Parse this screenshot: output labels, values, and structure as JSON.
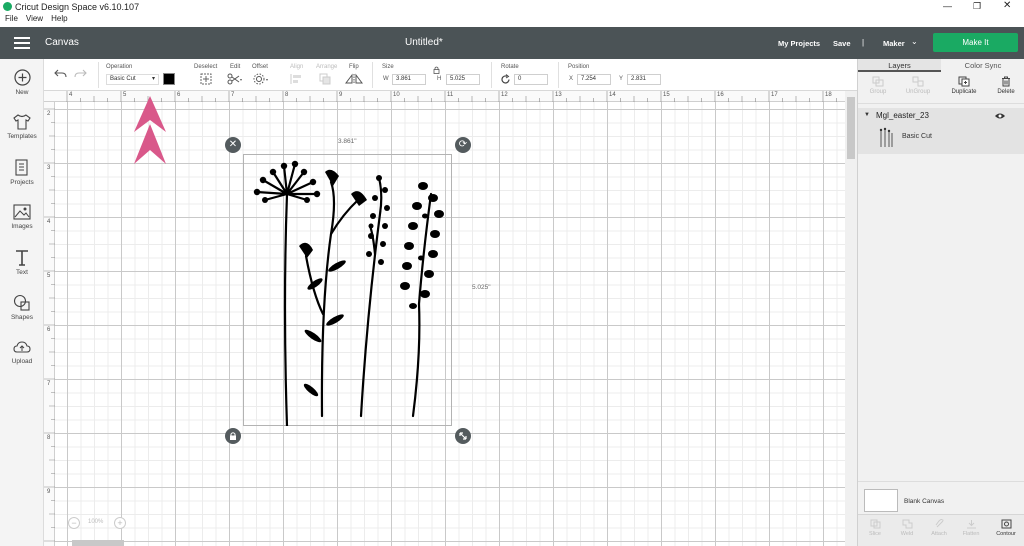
{
  "window": {
    "title": "Cricut Design Space  v6.10.107",
    "menu": [
      "File",
      "View",
      "Help"
    ]
  },
  "header": {
    "canvas_label": "Canvas",
    "doc_title": "Untitled*",
    "my_projects": "My Projects",
    "save": "Save",
    "separator": "|",
    "machine": "Maker",
    "make_it": "Make It",
    "accent": "#1aaa63"
  },
  "toolbar": {
    "operation_label": "Operation",
    "operation_value": "Basic Cut",
    "deselect": "Deselect",
    "edit": "Edit",
    "offset": "Offset",
    "align": "Align",
    "arrange": "Arrange",
    "flip": "Flip",
    "size_label": "Size",
    "w_label": "W",
    "w_value": "3.861",
    "h_label": "H",
    "h_value": "5.025",
    "rotate_label": "Rotate",
    "rotate_value": "0",
    "position_label": "Position",
    "x_label": "X",
    "x_value": "7.254",
    "y_label": "Y",
    "y_value": "2.831"
  },
  "nav": [
    {
      "label": "New",
      "icon": "plus-circle-icon"
    },
    {
      "label": "Templates",
      "icon": "shirt-icon"
    },
    {
      "label": "Projects",
      "icon": "projects-icon"
    },
    {
      "label": "Images",
      "icon": "image-icon"
    },
    {
      "label": "Text",
      "icon": "text-icon"
    },
    {
      "label": "Shapes",
      "icon": "shapes-icon"
    },
    {
      "label": "Upload",
      "icon": "upload-icon"
    }
  ],
  "ruler": {
    "top": [
      "4",
      "5",
      "6",
      "7",
      "8",
      "9",
      "10",
      "11",
      "12",
      "13",
      "14",
      "15",
      "16",
      "17",
      "18"
    ],
    "left": [
      "2",
      "3",
      "4",
      "5",
      "6",
      "7",
      "8",
      "9"
    ]
  },
  "selection": {
    "width_label": "3.861\"",
    "height_label": "5.025\""
  },
  "zoom": {
    "level": "100%"
  },
  "panel": {
    "tabs": [
      "Layers",
      "Color Sync"
    ],
    "actions": [
      "Group",
      "UnGroup",
      "Duplicate",
      "Delete"
    ],
    "layer_group": "Mgl_easter_23",
    "layer_item": "Basic Cut",
    "blank_canvas": "Blank Canvas",
    "bottom_actions": [
      "Slice",
      "Weld",
      "Attach",
      "Flatten",
      "Contour"
    ]
  },
  "annotation_color": "#d9588a"
}
